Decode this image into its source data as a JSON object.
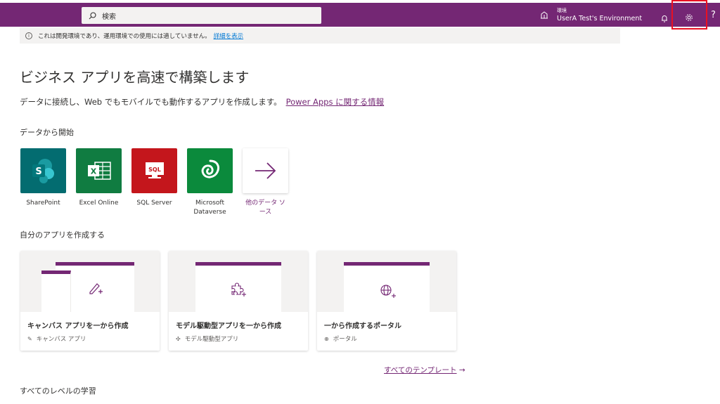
{
  "topbar": {
    "search_placeholder": "検索",
    "env_label": "環境",
    "env_name": "UserA Test's Environment",
    "help": "?"
  },
  "notice": {
    "text": "これは開発環境であり、運用環境での使用には適していません。",
    "link": "詳細を表示"
  },
  "main": {
    "title": "ビジネス アプリを高速で構築します",
    "subtitle": "データに接続し、Web でもモバイルでも動作するアプリを作成します。",
    "subtitle_link": "Power Apps に関する情報",
    "data_section": "データから開始",
    "sources": [
      {
        "label": "SharePoint",
        "color": "#036c70"
      },
      {
        "label": "Excel Online",
        "color": "#107c41"
      },
      {
        "label": "SQL Server",
        "color": "#c4161c"
      },
      {
        "label": "Microsoft Dataverse",
        "color": "#0b8a3c"
      },
      {
        "label": "他のデータ ソース"
      }
    ],
    "create_section": "自分のアプリを作成する",
    "cards": [
      {
        "title": "キャンバス アプリを一から作成",
        "tag": "キャンバス アプリ"
      },
      {
        "title": "モデル駆動型アプリを一から作成",
        "tag": "モデル駆動型アプリ"
      },
      {
        "title": "一から作成するポータル",
        "tag": "ポータル"
      }
    ],
    "all_templates": "すべてのテンプレート",
    "learn_section": "すべてのレベルの学習"
  },
  "colors": {
    "brand": "#742774",
    "highlight": "#e81123"
  }
}
